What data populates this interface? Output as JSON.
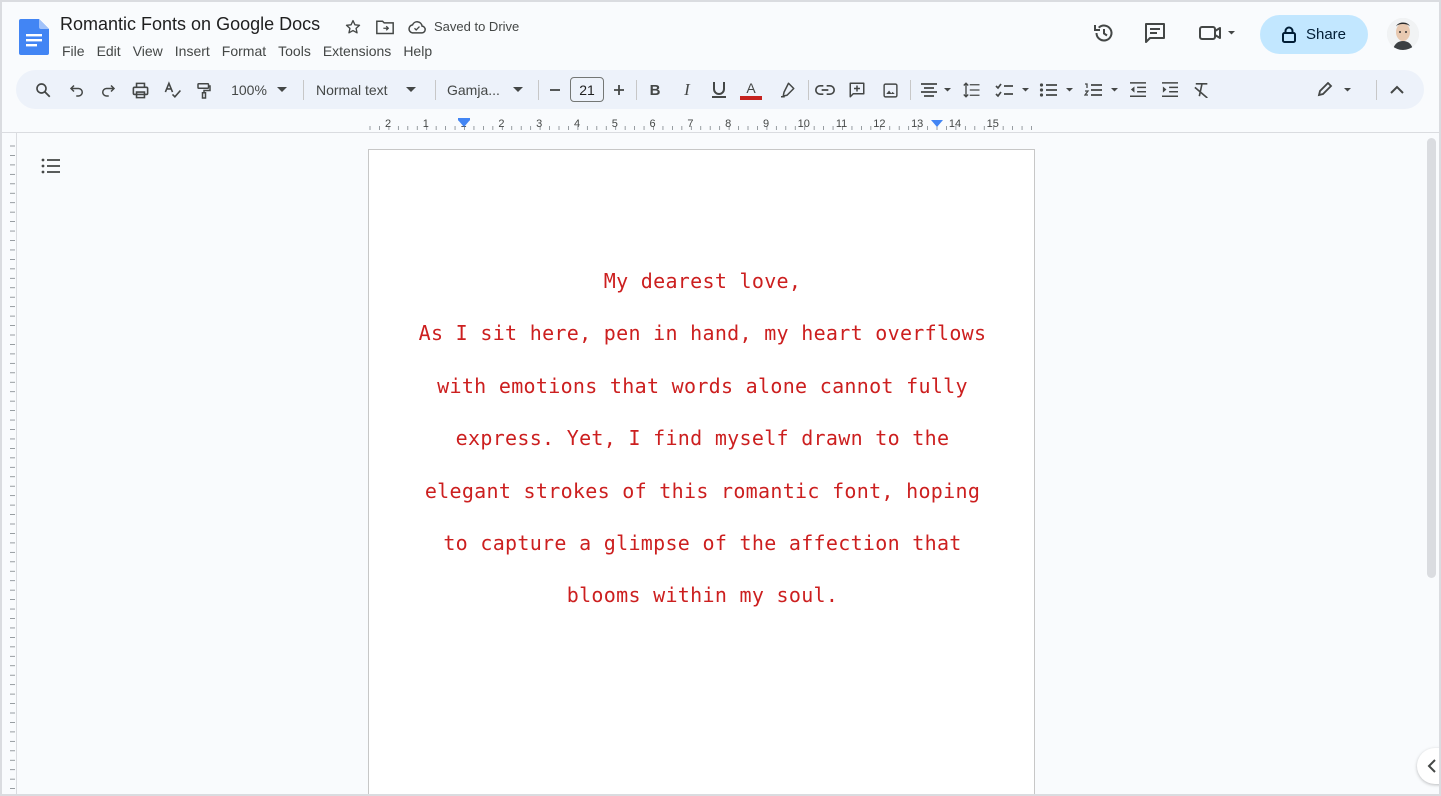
{
  "window": {
    "doc_title": "Romantic Fonts on Google Docs",
    "saved_status": "Saved to Drive"
  },
  "menu": {
    "items": [
      "File",
      "Edit",
      "View",
      "Insert",
      "Format",
      "Tools",
      "Extensions",
      "Help"
    ]
  },
  "header": {
    "share_label": "Share"
  },
  "toolbar": {
    "zoom": "100%",
    "style": "Normal text",
    "font": "Gamja...",
    "font_size": "21",
    "text_color": "#c5221f"
  },
  "ruler": {
    "labels": [
      "2",
      "1",
      "1",
      "2",
      "3",
      "4",
      "5",
      "6",
      "7",
      "8",
      "9",
      "10",
      "11",
      "12",
      "13",
      "14",
      "15"
    ]
  },
  "document": {
    "text_color": "#cc1f1f",
    "lines": [
      "My dearest love,",
      "As I sit here, pen in hand, my heart overflows",
      "with emotions that words alone cannot fully",
      "express. Yet, I find myself drawn to the",
      "elegant strokes of this romantic font, hoping",
      "to capture a glimpse of the affection that",
      "blooms within my soul."
    ]
  }
}
